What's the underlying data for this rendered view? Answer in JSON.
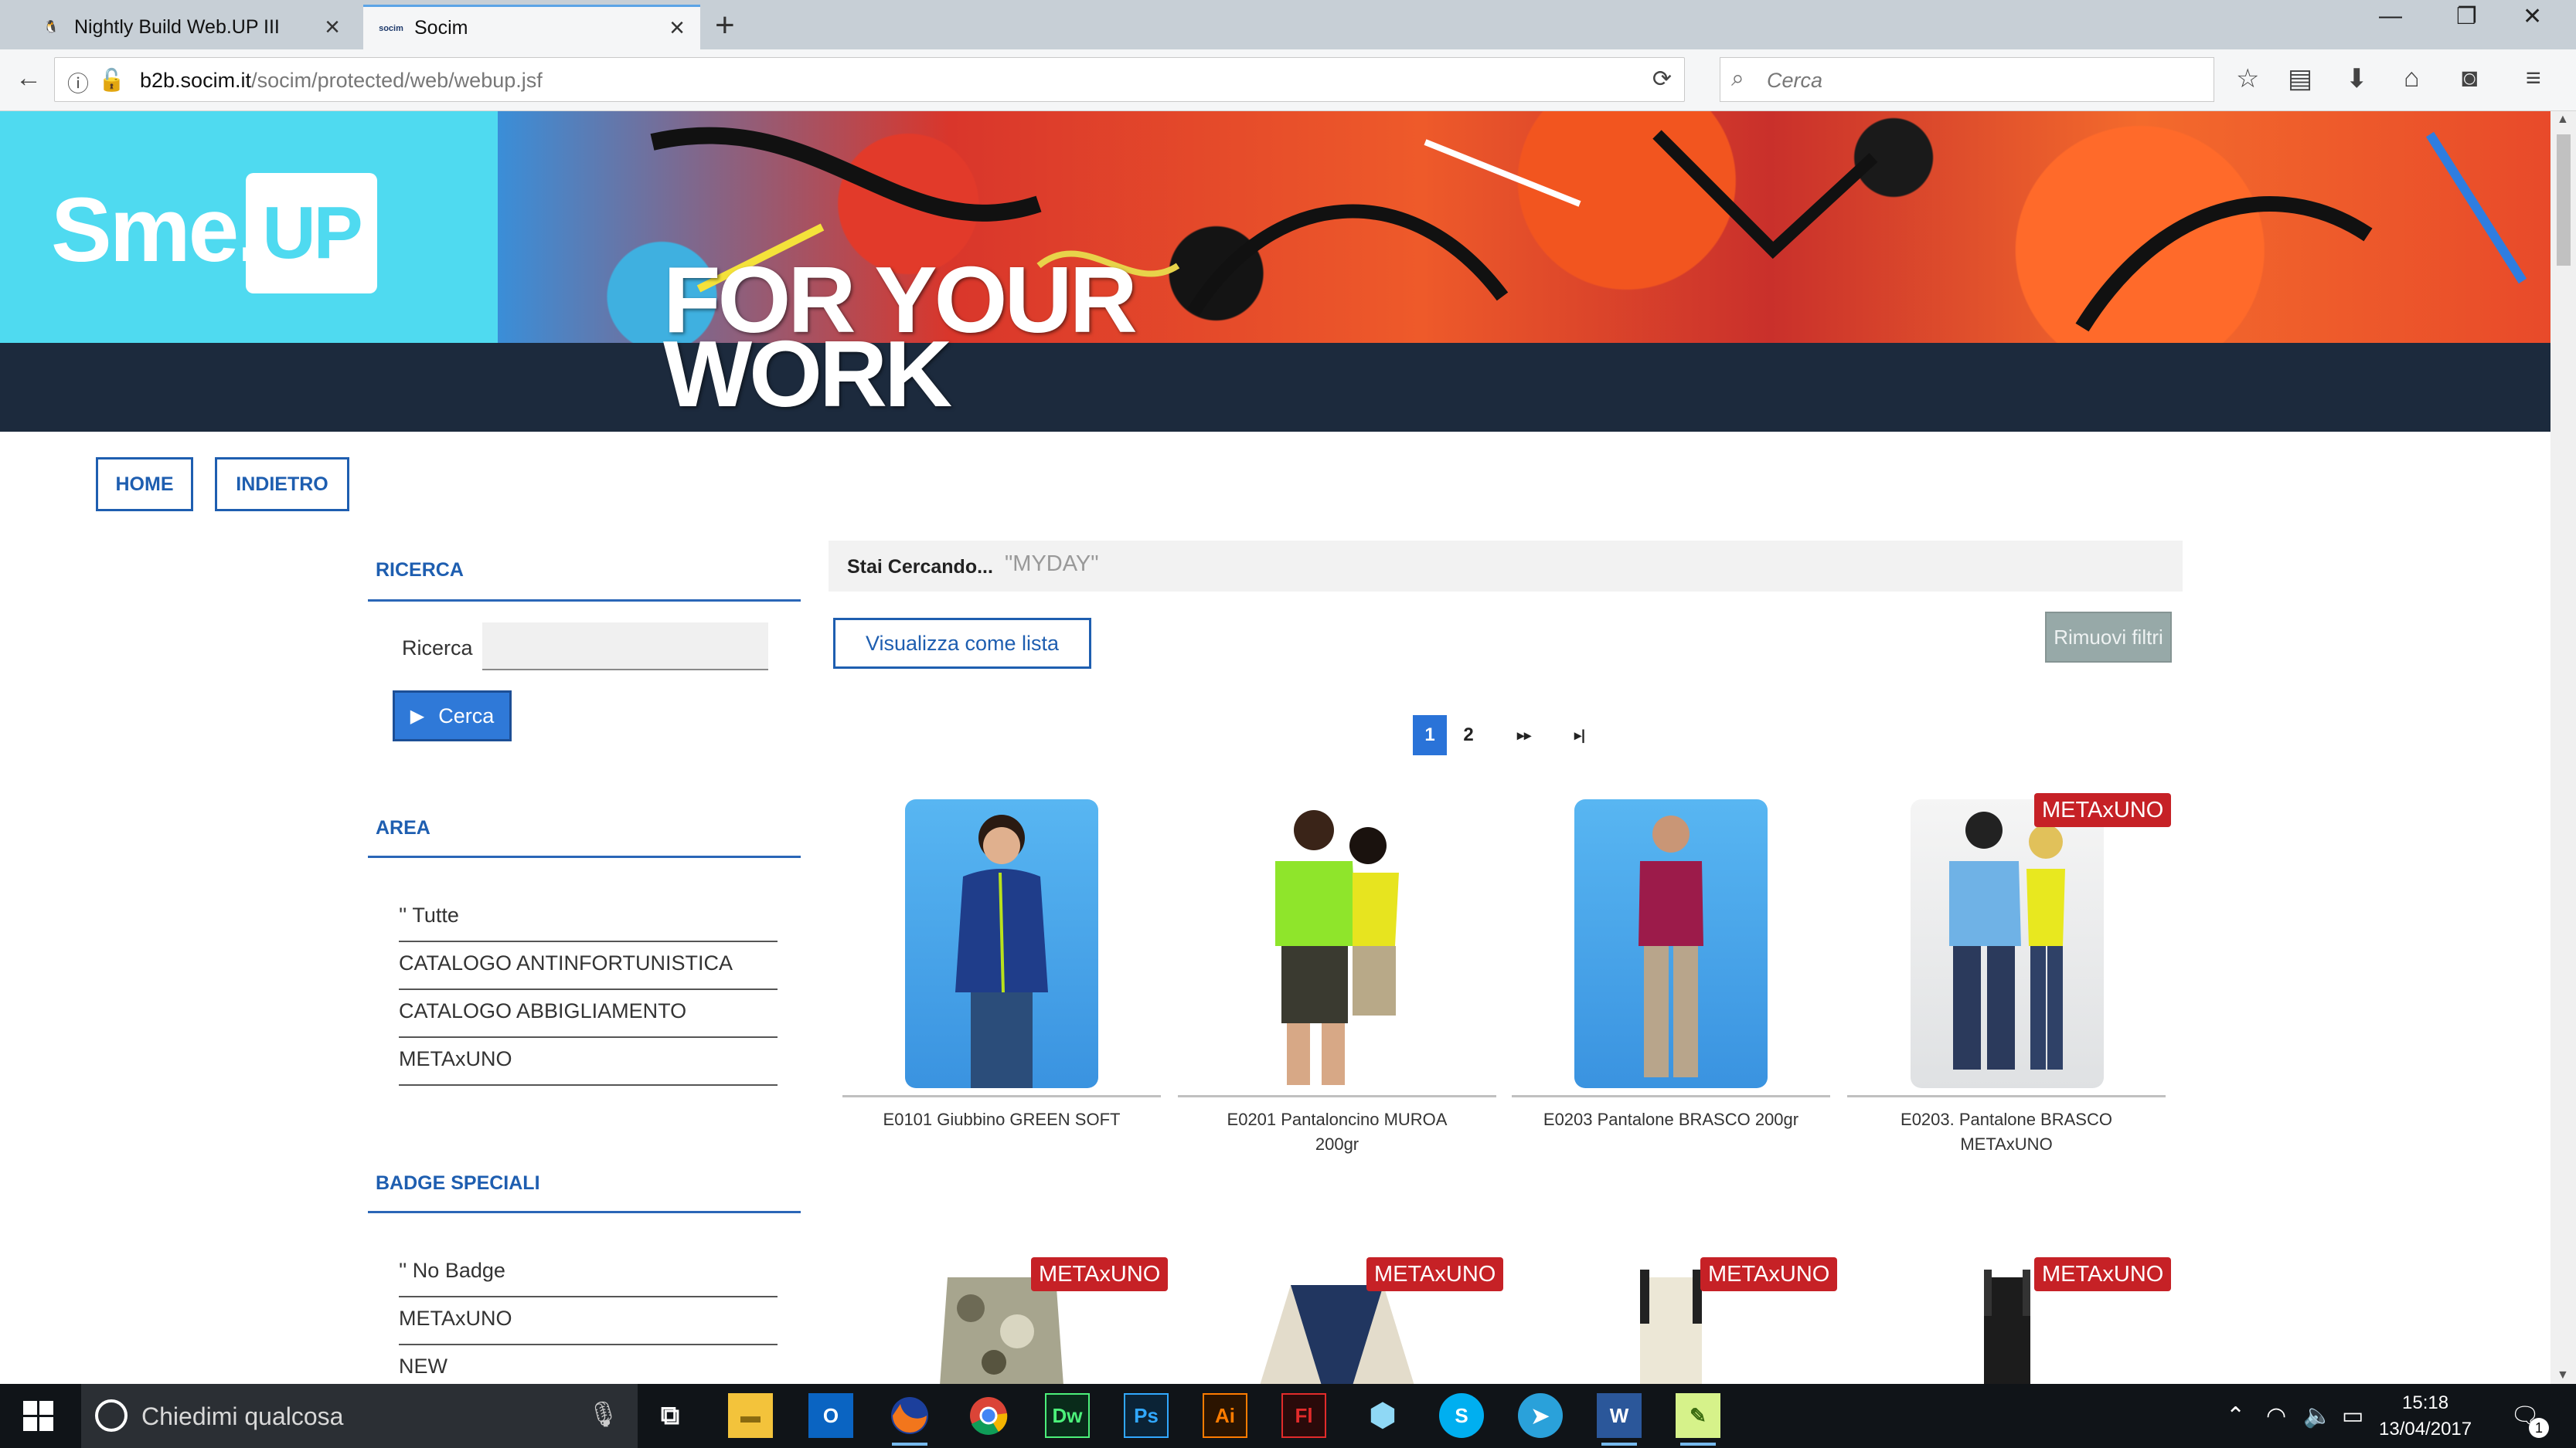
{
  "browser": {
    "tabs": [
      {
        "label": "Nightly Build Web.UP III",
        "active": false
      },
      {
        "label": "Socim",
        "active": true
      }
    ],
    "url_host": "b2b.socim.it",
    "url_path": "/socim/protected/web/webup.jsf",
    "search_placeholder": "Cerca"
  },
  "header": {
    "logo_text": "Sme.",
    "logo_box": "UP",
    "tagline_line1": "FOR YOUR",
    "tagline_line2": "WORK"
  },
  "nav": {
    "home": "HOME",
    "back": "INDIETRO"
  },
  "sidebar": {
    "search_title": "RICERCA",
    "search_label": "Ricerca",
    "search_value": "",
    "search_button": "Cerca",
    "area_title": "AREA",
    "area_items": [
      "'' Tutte",
      "CATALOGO ANTINFORTUNISTICA",
      "CATALOGO ABBIGLIAMENTO",
      "METAxUNO"
    ],
    "badge_title": "BADGE SPECIALI",
    "badge_items": [
      "'' No Badge",
      "METAxUNO",
      "NEW"
    ]
  },
  "results": {
    "searching_label": "Stai Cercando...",
    "searching_value": "\"MYDAY\"",
    "view_list": "Visualizza come lista",
    "remove_filters": "Rimuovi filtri",
    "pages": [
      "1",
      "2"
    ],
    "current_page": "1",
    "next_icon": "▸▸",
    "last_icon": "▸|",
    "products_row1": [
      {
        "title": "E0101 Giubbino GREEN SOFT",
        "badge": ""
      },
      {
        "title": "E0201 Pantaloncino MUROA 200gr",
        "badge": ""
      },
      {
        "title": "E0203 Pantalone BRASCO 200gr",
        "badge": ""
      },
      {
        "title": "E0203. Pantalone BRASCO METAxUNO",
        "badge": "METAxUNO"
      }
    ],
    "products_row2_badges": [
      "METAxUNO",
      "METAxUNO",
      "METAxUNO",
      "METAxUNO"
    ]
  },
  "taskbar": {
    "search_placeholder": "Chiedimi qualcosa",
    "time": "15:18",
    "date": "13/04/2017",
    "notification_count": "1"
  }
}
